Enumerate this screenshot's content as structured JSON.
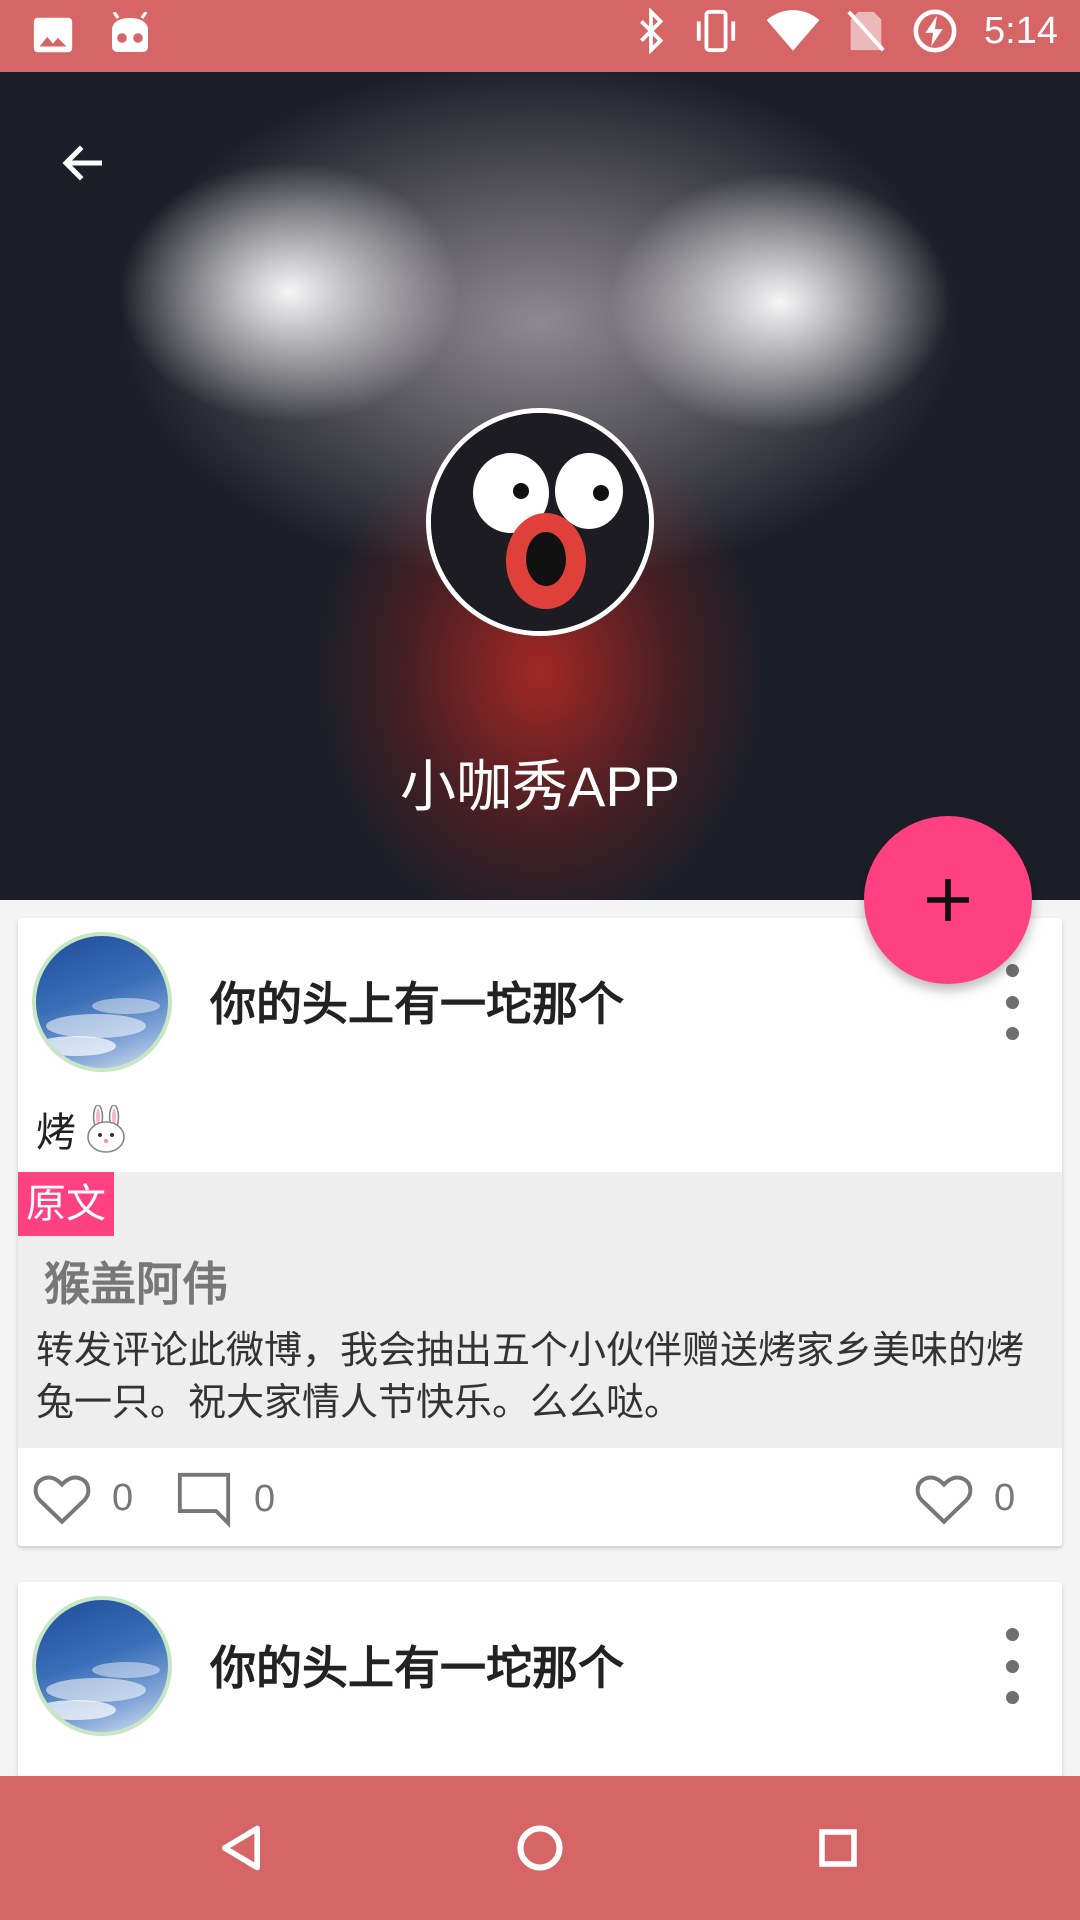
{
  "status_bar": {
    "time": "5:14",
    "left_icons": [
      "image-icon",
      "android-icon"
    ],
    "right_icons": [
      "bluetooth-icon",
      "vibrate-icon",
      "wifi-icon",
      "no-sim-icon",
      "battery-charging-icon"
    ]
  },
  "header": {
    "title": "小咖秀APP",
    "back_icon": "arrow-left-icon"
  },
  "fab": {
    "icon": "plus-icon"
  },
  "feed": [
    {
      "user_name": "你的头上有一坨那个",
      "text": "烤",
      "quote": {
        "tag": "原文",
        "author": "猴盖阿伟",
        "text": "转发评论此微博，我会抽出五个小伙伴赠送烤家乡美味的烤兔一只。祝大家情人节快乐。么么哒。"
      },
      "actions": {
        "likes": "0",
        "comments": "0",
        "reposts": "0"
      }
    },
    {
      "user_name": "你的头上有一坨那个"
    }
  ],
  "colors": {
    "bar": "#d66566",
    "accent": "#ff4081"
  }
}
